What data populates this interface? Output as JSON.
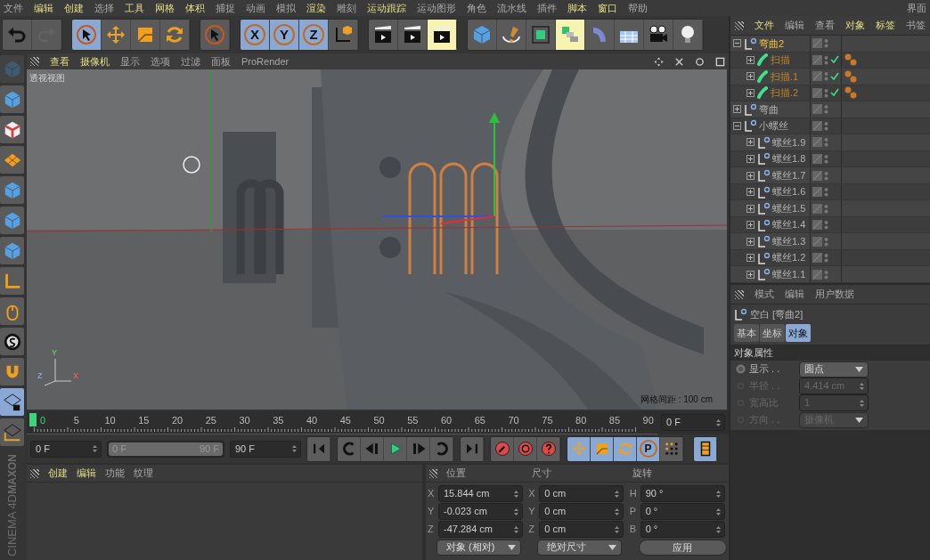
{
  "menu": [
    {
      "label": "文件",
      "highlighted": false
    },
    {
      "label": "编辑",
      "highlighted": true
    },
    {
      "label": "创建",
      "highlighted": true
    },
    {
      "label": "选择",
      "highlighted": false
    },
    {
      "label": "工具",
      "highlighted": true
    },
    {
      "label": "网格",
      "highlighted": true
    },
    {
      "label": "体积",
      "highlighted": true
    },
    {
      "label": "捕捉",
      "highlighted": false
    },
    {
      "label": "动画",
      "highlighted": false
    },
    {
      "label": "模拟",
      "highlighted": false
    },
    {
      "label": "渲染",
      "highlighted": true
    },
    {
      "label": "雕刻",
      "highlighted": false
    },
    {
      "label": "运动跟踪",
      "highlighted": true
    },
    {
      "label": "运动图形",
      "highlighted": false
    },
    {
      "label": "角色",
      "highlighted": false
    },
    {
      "label": "流水线",
      "highlighted": false
    },
    {
      "label": "插件",
      "highlighted": false
    },
    {
      "label": "脚本",
      "highlighted": true
    },
    {
      "label": "窗口",
      "highlighted": true
    },
    {
      "label": "帮助",
      "highlighted": false
    }
  ],
  "layout_label": "界面",
  "toolbar": [
    [
      {
        "kind": "undo",
        "selected": false,
        "active": false,
        "disabled": false
      },
      {
        "kind": "redo",
        "selected": false,
        "active": false,
        "disabled": true
      }
    ],
    [
      {
        "kind": "cursor",
        "selected": true,
        "active": false,
        "disabled": false
      },
      {
        "kind": "move",
        "selected": false,
        "active": false,
        "disabled": false
      },
      {
        "kind": "scale",
        "selected": false,
        "active": false,
        "disabled": false
      },
      {
        "kind": "rotate",
        "selected": false,
        "active": false,
        "disabled": false
      }
    ],
    [
      {
        "kind": "cursor",
        "selected": false,
        "active": false,
        "disabled": false
      }
    ],
    [
      {
        "kind": "axis",
        "label": "X",
        "selected": true,
        "active": false,
        "disabled": false
      },
      {
        "kind": "axis",
        "label": "Y",
        "selected": true,
        "active": false,
        "disabled": false
      },
      {
        "kind": "axis",
        "label": "Z",
        "selected": true,
        "active": false,
        "disabled": false
      },
      {
        "kind": "coord",
        "selected": false,
        "active": false,
        "disabled": false
      }
    ],
    [
      {
        "kind": "clapper",
        "selected": false,
        "active": false,
        "disabled": false
      },
      {
        "kind": "clapper",
        "selected": false,
        "active": false,
        "disabled": false
      },
      {
        "kind": "clapper",
        "selected": false,
        "active": true,
        "disabled": false
      }
    ],
    [
      {
        "kind": "cube",
        "selected": false,
        "active": false,
        "disabled": false
      },
      {
        "kind": "pen",
        "selected": false,
        "active": false,
        "disabled": false
      },
      {
        "kind": "subdiv",
        "selected": false,
        "active": false,
        "disabled": false
      },
      {
        "kind": "array",
        "selected": false,
        "active": true,
        "disabled": false
      },
      {
        "kind": "bend",
        "selected": false,
        "active": false,
        "disabled": false
      },
      {
        "kind": "floor",
        "selected": false,
        "active": false,
        "disabled": false
      },
      {
        "kind": "camera",
        "selected": false,
        "active": false,
        "disabled": false
      },
      {
        "kind": "bulb",
        "selected": false,
        "active": false,
        "disabled": false
      }
    ]
  ],
  "side_toolbar": [
    {
      "kind": "cube",
      "selected": false,
      "disabled": true
    },
    {
      "kind": "cube",
      "selected": false,
      "disabled": false
    },
    {
      "kind": "checker",
      "selected": false,
      "disabled": false
    },
    {
      "kind": "mesh",
      "selected": false,
      "disabled": false
    },
    {
      "kind": "cube",
      "selected": false,
      "disabled": false
    },
    {
      "kind": "cube",
      "selected": false,
      "disabled": false
    },
    {
      "kind": "cube",
      "selected": false,
      "disabled": false
    },
    {
      "kind": "corner",
      "selected": false,
      "disabled": false
    },
    {
      "kind": "mouse",
      "selected": false,
      "disabled": false
    },
    {
      "kind": "snap",
      "selected": false,
      "disabled": false
    },
    {
      "kind": "magnet",
      "selected": false,
      "disabled": false
    },
    {
      "kind": "lockgrid",
      "selected": true,
      "disabled": false
    },
    {
      "kind": "gridaxis",
      "selected": false,
      "disabled": false
    }
  ],
  "brand": {
    "company": "MAXON",
    "product": "CINEMA 4D"
  },
  "viewport": {
    "menu": [
      {
        "label": "查看",
        "highlighted": true
      },
      {
        "label": "摄像机",
        "highlighted": true
      },
      {
        "label": "显示",
        "highlighted": false
      },
      {
        "label": "选项",
        "highlighted": false
      },
      {
        "label": "过滤",
        "highlighted": false
      },
      {
        "label": "面板",
        "highlighted": false
      },
      {
        "label": "ProRender",
        "highlighted": false
      }
    ],
    "view_name": "透视视图",
    "grid_info": "网格间距 : 100 cm",
    "axes": [
      "Y",
      "Z",
      "X"
    ]
  },
  "timeline": {
    "ticks": [
      "0",
      "5",
      "10",
      "15",
      "20",
      "25",
      "30",
      "35",
      "40",
      "45",
      "50",
      "55",
      "60",
      "65",
      "70",
      "75",
      "80",
      "85",
      "90"
    ],
    "level": 0,
    "current_frame": "0 F"
  },
  "transport": {
    "start_field": "0 F",
    "range": {
      "from": "0 F",
      "to": "90 F",
      "level": 1
    },
    "end_field": "90 F",
    "button_groups": [
      [
        {
          "kind": "go-start"
        }
      ],
      [
        {
          "kind": "prev-key"
        },
        {
          "kind": "prev-frame"
        },
        {
          "kind": "play"
        },
        {
          "kind": "next-frame"
        },
        {
          "kind": "next-key"
        }
      ],
      [
        {
          "kind": "go-end"
        }
      ],
      [
        {
          "kind": "record"
        },
        {
          "kind": "autokey"
        },
        {
          "kind": "help"
        }
      ]
    ],
    "modes": [
      {
        "kind": "move",
        "selected": true
      },
      {
        "kind": "scale",
        "selected": true
      },
      {
        "kind": "rotate",
        "selected": true
      },
      {
        "kind": "axis",
        "label": "P",
        "selected": true
      },
      {
        "kind": "dots",
        "selected": false
      }
    ],
    "film": {
      "selected": true
    }
  },
  "material_manager": {
    "menu": [
      {
        "label": "创建",
        "highlighted": true
      },
      {
        "label": "编辑",
        "highlighted": true
      },
      {
        "label": "功能",
        "highlighted": false
      },
      {
        "label": "纹理",
        "highlighted": false
      }
    ]
  },
  "coordinates": {
    "columns": [
      {
        "header": "位置",
        "rows": [
          {
            "axis": "X",
            "value": "15.844 cm"
          },
          {
            "axis": "Y",
            "value": "-0.023 cm"
          },
          {
            "axis": "Z",
            "value": "-47.284 cm"
          }
        ],
        "dropdown": "对象 (相对)"
      },
      {
        "header": "尺寸",
        "rows": [
          {
            "axis": "X",
            "value": "0 cm"
          },
          {
            "axis": "Y",
            "value": "0 cm"
          },
          {
            "axis": "Z",
            "value": "0 cm"
          }
        ],
        "dropdown": "绝对尺寸"
      },
      {
        "header": "旋转",
        "rows": [
          {
            "axis": "H",
            "value": "90 °"
          },
          {
            "axis": "P",
            "value": "0 °"
          },
          {
            "axis": "B",
            "value": "0 °"
          }
        ],
        "button": "应用"
      }
    ]
  },
  "object_manager": {
    "menu": [
      {
        "label": "文件",
        "highlighted": true
      },
      {
        "label": "编辑",
        "highlighted": false
      },
      {
        "label": "查看",
        "highlighted": false
      },
      {
        "label": "对象",
        "highlighted": true
      },
      {
        "label": "标签",
        "highlighted": true
      },
      {
        "label": "书签",
        "highlighted": false
      }
    ],
    "tree": [
      {
        "name": "弯曲2",
        "kind": "null",
        "selected": true,
        "highlighted": false,
        "expanded": true,
        "checked": false,
        "tagged": false,
        "children": [
          {
            "name": "扫描",
            "kind": "sweep",
            "selected": false,
            "highlighted": true,
            "expanded": false,
            "checked": true,
            "tagged": true
          },
          {
            "name": "扫描.1",
            "kind": "sweep",
            "selected": false,
            "highlighted": true,
            "expanded": false,
            "checked": true,
            "tagged": true
          },
          {
            "name": "扫描.2",
            "kind": "sweep",
            "selected": false,
            "highlighted": true,
            "expanded": false,
            "checked": true,
            "tagged": true
          }
        ]
      },
      {
        "name": "弯曲",
        "kind": "null",
        "selected": false,
        "highlighted": false,
        "expanded": false,
        "checked": false,
        "tagged": false
      },
      {
        "name": "小螺丝",
        "kind": "null",
        "selected": false,
        "highlighted": false,
        "expanded": true,
        "checked": false,
        "tagged": false,
        "children": [
          {
            "name": "螺丝1.9",
            "kind": "null",
            "selected": false,
            "highlighted": false,
            "expanded": false,
            "checked": false,
            "tagged": false
          },
          {
            "name": "螺丝1.8",
            "kind": "null",
            "selected": false,
            "highlighted": false,
            "expanded": false,
            "checked": false,
            "tagged": false
          },
          {
            "name": "螺丝1.7",
            "kind": "null",
            "selected": false,
            "highlighted": false,
            "expanded": false,
            "checked": false,
            "tagged": false
          },
          {
            "name": "螺丝1.6",
            "kind": "null",
            "selected": false,
            "highlighted": false,
            "expanded": false,
            "checked": false,
            "tagged": false
          },
          {
            "name": "螺丝1.5",
            "kind": "null",
            "selected": false,
            "highlighted": false,
            "expanded": false,
            "checked": false,
            "tagged": false
          },
          {
            "name": "螺丝1.4",
            "kind": "null",
            "selected": false,
            "highlighted": false,
            "expanded": false,
            "checked": false,
            "tagged": false
          },
          {
            "name": "螺丝1.3",
            "kind": "null",
            "selected": false,
            "highlighted": false,
            "expanded": false,
            "checked": false,
            "tagged": false
          },
          {
            "name": "螺丝1.2",
            "kind": "null",
            "selected": false,
            "highlighted": false,
            "expanded": false,
            "checked": false,
            "tagged": false
          },
          {
            "name": "螺丝1.1",
            "kind": "null",
            "selected": false,
            "highlighted": false,
            "expanded": false,
            "checked": false,
            "tagged": false
          }
        ]
      }
    ]
  },
  "attributes": {
    "menu": [
      {
        "label": "模式",
        "highlighted": false
      },
      {
        "label": "编辑",
        "highlighted": false
      },
      {
        "label": "用户数据",
        "highlighted": false
      }
    ],
    "title": "空白 [弯曲2]",
    "tabs": [
      {
        "label": "基本",
        "selected": false
      },
      {
        "label": "坐标",
        "selected": false
      },
      {
        "label": "对象",
        "selected": true
      }
    ],
    "section": "对象属性",
    "properties": [
      {
        "label": "显示 . .",
        "kind": "dropdown",
        "value": "圆点",
        "disabled": false
      },
      {
        "label": "半径 . .",
        "kind": "number",
        "value": "4.414 cm",
        "disabled": true
      },
      {
        "label": "宽高比",
        "kind": "number",
        "value": "1",
        "disabled": true
      },
      {
        "label": "方向 . .",
        "kind": "dropdown",
        "value": "摄像机",
        "disabled": true
      }
    ]
  }
}
